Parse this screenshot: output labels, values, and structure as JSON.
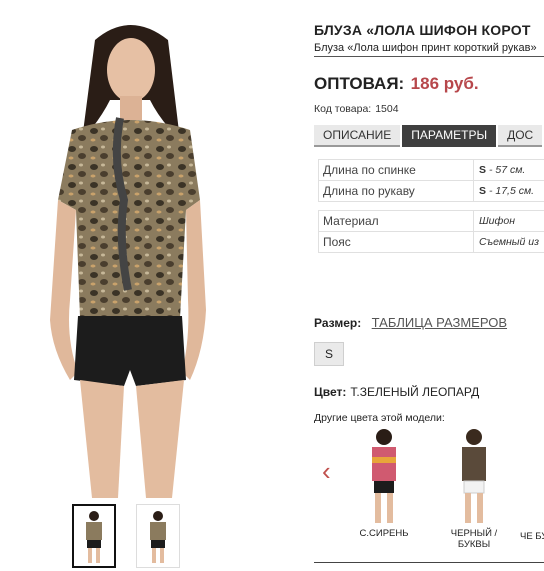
{
  "product": {
    "title": "БЛУЗА «ЛОЛА ШИФОН КОРОТ",
    "subtitle": "Блуза «Лола шифон принт короткий рукав»",
    "price_label": "ОПТОВАЯ:",
    "price_value": "186 руб.",
    "code_label": "Код товара:",
    "code_value": "1504"
  },
  "tabs": [
    {
      "label": "Описание",
      "active": false
    },
    {
      "label": "Параметры",
      "active": true
    },
    {
      "label": "Дос",
      "active": false
    }
  ],
  "params": [
    {
      "name": "Длина по спинке",
      "size": "S",
      "value": "- 57 см."
    },
    {
      "name": "Длина по рукаву",
      "size": "S",
      "value": "- 17,5 см."
    },
    {
      "name": "Материал",
      "size": "",
      "value": "Шифон"
    },
    {
      "name": "Пояс",
      "size": "",
      "value": "Съемный из"
    }
  ],
  "size": {
    "label": "Размер:",
    "table_link": "ТАБЛИЦА РАЗМЕРОВ",
    "option": "S"
  },
  "color": {
    "label": "Цвет:",
    "value": "Т.зеленый леопард"
  },
  "other_colors_label": "Другие цвета этой модели:",
  "variants": [
    {
      "name": "С.СИРЕНЬ"
    },
    {
      "name": "ЧЕРНЫЙ / БУКВЫ"
    },
    {
      "name": "ЧЕ БУК"
    }
  ],
  "icons": {
    "prev": "chevron-left-icon"
  },
  "colors": {
    "accent": "#b7474b",
    "tab_active": "#3f3f3f",
    "tab_inactive": "#e9e9e9",
    "arrow": "#c0504d"
  }
}
